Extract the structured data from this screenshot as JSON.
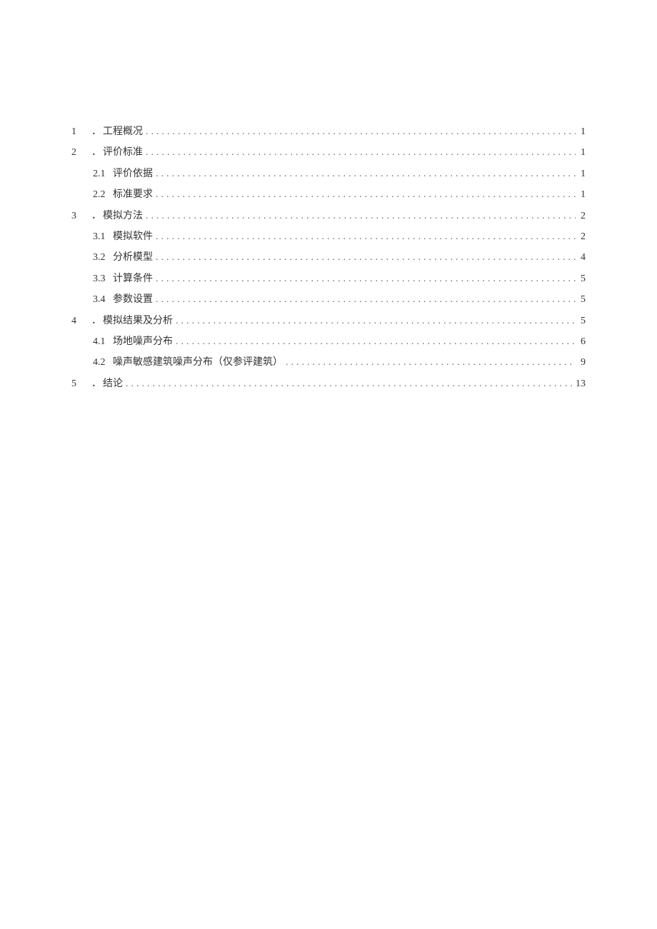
{
  "toc": [
    {
      "level": 1,
      "number": "1",
      "sep": "．",
      "title": "工程概况",
      "page": "1"
    },
    {
      "level": 1,
      "number": "2",
      "sep": "．",
      "title": "评价标准",
      "page": "1"
    },
    {
      "level": 2,
      "number": "2.1",
      "sep": "",
      "title": "评价依据",
      "page": "1"
    },
    {
      "level": 2,
      "number": "2.2",
      "sep": "",
      "title": "标准要求",
      "page": "1"
    },
    {
      "level": 1,
      "number": "3",
      "sep": "．",
      "title": "模拟方法",
      "page": "2"
    },
    {
      "level": 2,
      "number": "3.1",
      "sep": "",
      "title": "模拟软件",
      "page": "2"
    },
    {
      "level": 2,
      "number": "3.2",
      "sep": "",
      "title": "分析模型",
      "page": "4"
    },
    {
      "level": 2,
      "number": "3.3",
      "sep": "",
      "title": "计算条件",
      "page": "5"
    },
    {
      "level": 2,
      "number": "3.4",
      "sep": "",
      "title": "参数设置",
      "page": "5"
    },
    {
      "level": 1,
      "number": "4",
      "sep": "．",
      "title": "模拟结果及分析",
      "page": "5"
    },
    {
      "level": 2,
      "number": "4.1",
      "sep": "",
      "title": "场地噪声分布",
      "page": "6"
    },
    {
      "level": 2,
      "number": "4.2",
      "sep": "",
      "title": "噪声敏感建筑噪声分布（仅参评建筑）",
      "page": "9"
    },
    {
      "level": 1,
      "number": "5",
      "sep": "．",
      "title": "结论",
      "page": "13"
    }
  ]
}
